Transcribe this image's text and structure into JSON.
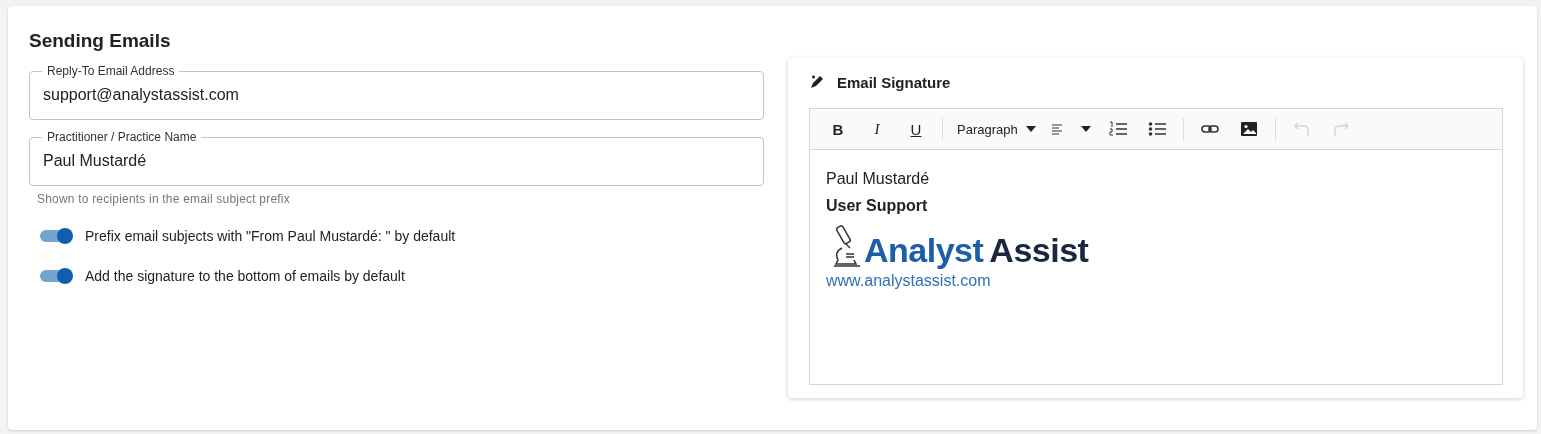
{
  "section": {
    "title": "Sending Emails"
  },
  "fields": [
    {
      "label": "Reply-To Email Address",
      "value": "support@analystassist.com"
    },
    {
      "label": "Practitioner / Practice Name",
      "value": "Paul Mustardé",
      "helper": "Shown to recipients in the email subject prefix"
    }
  ],
  "toggles": [
    {
      "label": "Prefix email subjects with \"From Paul Mustardé: \" by default",
      "on": true
    },
    {
      "label": "Add the signature to the bottom of emails by default",
      "on": true
    }
  ],
  "signature_editor": {
    "title": "Email Signature",
    "toolbar": [
      [
        {
          "kind": "bold",
          "label": "B"
        },
        {
          "kind": "italic",
          "label": "I"
        },
        {
          "kind": "underline",
          "label": "U"
        }
      ],
      [
        {
          "kind": "block-format",
          "label": "Paragraph"
        },
        {
          "kind": "align"
        },
        {
          "kind": "numbered-list"
        },
        {
          "kind": "bullet-list"
        }
      ],
      [
        {
          "kind": "link"
        },
        {
          "kind": "image"
        }
      ],
      [
        {
          "kind": "undo",
          "disabled": true
        },
        {
          "kind": "redo",
          "disabled": true
        }
      ]
    ],
    "content": [
      {
        "kind": "text",
        "text": "Paul Mustardé"
      },
      {
        "kind": "bold",
        "text": "User Support"
      },
      {
        "kind": "logo",
        "parts": [
          "Analyst",
          "Assist"
        ]
      },
      {
        "kind": "link",
        "text": "www.analystassist.com"
      }
    ]
  }
}
